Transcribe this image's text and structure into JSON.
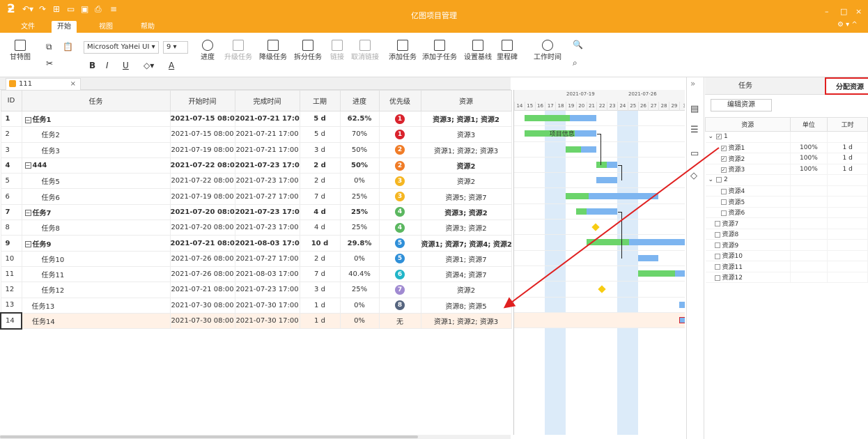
{
  "app": {
    "title": "亿图项目管理",
    "logo": "ƻ"
  },
  "menus": [
    "文件",
    "开始",
    "视图",
    "帮助"
  ],
  "window": {
    "minimize": "–",
    "maximize": "□",
    "close": "×",
    "settings": "⚙ ▾ ^"
  },
  "ribbon": {
    "gantt": "甘特图",
    "font": "Microsoft YaHei UI",
    "font_size": "9",
    "bold": "B",
    "italic": "I",
    "underline": "U",
    "font_color": "A",
    "progress": "进度",
    "upgrade": "升级任务",
    "downgrade": "降级任务",
    "split": "拆分任务",
    "link": "链接",
    "unlink": "取消链接",
    "add_task": "添加任务",
    "add_subtask": "添加子任务",
    "baseline": "设置基线",
    "milestone": "里程碑",
    "work_time": "工作时间"
  },
  "doc_tab": {
    "name": "111",
    "close": "×"
  },
  "columns": {
    "id": "ID",
    "task": "任务",
    "start": "开始时间",
    "finish": "完成时间",
    "duration": "工期",
    "progress": "进度",
    "priority": "优先级",
    "resource": "资源"
  },
  "tasks": [
    {
      "id": "1",
      "name": "任务1",
      "start": "2021-07-15 08:00",
      "finish": "2021-07-21 17:00",
      "duration": "5 d",
      "progress": "62.5%",
      "priority": "1",
      "pcolor": "#d9232d",
      "resource": "资源3; 资源1; 资源2",
      "summary": true
    },
    {
      "id": "2",
      "name": "任务2",
      "start": "2021-07-15 08:00",
      "finish": "2021-07-21 17:00",
      "duration": "5 d",
      "progress": "70%",
      "priority": "1",
      "pcolor": "#d9232d",
      "resource": "资源3",
      "summary": false
    },
    {
      "id": "3",
      "name": "任务3",
      "start": "2021-07-19 08:00",
      "finish": "2021-07-21 17:00",
      "duration": "3 d",
      "progress": "50%",
      "priority": "2",
      "pcolor": "#f07c27",
      "resource": "资源1; 资源2; 资源3",
      "summary": false
    },
    {
      "id": "4",
      "name": "444",
      "start": "2021-07-22 08:00",
      "finish": "2021-07-23 17:00",
      "duration": "2 d",
      "progress": "50%",
      "priority": "2",
      "pcolor": "#f07c27",
      "resource": "资源2",
      "summary": true
    },
    {
      "id": "5",
      "name": "任务5",
      "start": "2021-07-22 08:00",
      "finish": "2021-07-23 17:00",
      "duration": "2 d",
      "progress": "0%",
      "priority": "3",
      "pcolor": "#f5b621",
      "resource": "资源2",
      "summary": false
    },
    {
      "id": "6",
      "name": "任务6",
      "start": "2021-07-19 08:00",
      "finish": "2021-07-27 17:00",
      "duration": "7 d",
      "progress": "25%",
      "priority": "3",
      "pcolor": "#f5b621",
      "resource": "资源5; 资源7",
      "summary": false
    },
    {
      "id": "7",
      "name": "任务7",
      "start": "2021-07-20 08:00",
      "finish": "2021-07-23 17:00",
      "duration": "4 d",
      "progress": "25%",
      "priority": "4",
      "pcolor": "#5bb760",
      "resource": "资源3; 资源2",
      "summary": true
    },
    {
      "id": "8",
      "name": "任务8",
      "start": "2021-07-20 08:00",
      "finish": "2021-07-23 17:00",
      "duration": "4 d",
      "progress": "25%",
      "priority": "4",
      "pcolor": "#5bb760",
      "resource": "资源3; 资源2",
      "summary": false
    },
    {
      "id": "9",
      "name": "任务9",
      "start": "2021-07-21 08:00",
      "finish": "2021-08-03 17:00",
      "duration": "10 d",
      "progress": "29.8%",
      "priority": "5",
      "pcolor": "#2f8fd8",
      "resource": "资源1; 资源7; 资源4; 资源2",
      "summary": true
    },
    {
      "id": "10",
      "name": "任务10",
      "start": "2021-07-26 08:00",
      "finish": "2021-07-27 17:00",
      "duration": "2 d",
      "progress": "0%",
      "priority": "5",
      "pcolor": "#2f8fd8",
      "resource": "资源1; 资源7",
      "summary": false
    },
    {
      "id": "11",
      "name": "任务11",
      "start": "2021-07-26 08:00",
      "finish": "2021-08-03 17:00",
      "duration": "7 d",
      "progress": "40.4%",
      "priority": "6",
      "pcolor": "#21b5c8",
      "resource": "资源4; 资源7",
      "summary": false
    },
    {
      "id": "12",
      "name": "任务12",
      "start": "2021-07-21 08:00",
      "finish": "2021-07-23 17:00",
      "duration": "3 d",
      "progress": "25%",
      "priority": "7",
      "pcolor": "#a08ad1",
      "resource": "资源2",
      "summary": false
    },
    {
      "id": "13",
      "name": "任务13",
      "start": "2021-07-30 08:00",
      "finish": "2021-07-30 17:00",
      "duration": "1 d",
      "progress": "0%",
      "priority": "8",
      "pcolor": "#56657f",
      "resource": "资源8; 资源5",
      "summary": false
    },
    {
      "id": "14",
      "name": "任务14",
      "start": "2021-07-30 08:00",
      "finish": "2021-07-30 17:00",
      "duration": "1 d",
      "progress": "0%",
      "priority": "无",
      "pcolor": "",
      "resource": "资源1; 资源2; 资源3",
      "summary": false
    }
  ],
  "gantt": {
    "weeks": [
      "2021-07-19",
      "2021-07-26"
    ],
    "days": [
      "14",
      "15",
      "16",
      "17",
      "18",
      "19",
      "20",
      "21",
      "22",
      "23",
      "24",
      "25",
      "26",
      "27",
      "28",
      "29",
      "3"
    ],
    "bar_label": "项目信息"
  },
  "panel": {
    "tab_task": "任务",
    "tab_resource": "分配资源",
    "edit": "编辑资源",
    "col_res": "资源",
    "col_unit": "单位",
    "col_work": "工时",
    "rows": [
      {
        "label": "1",
        "level": 0,
        "expand": "⌄",
        "checked": true,
        "unit": "",
        "work": ""
      },
      {
        "label": "资源1",
        "level": 1,
        "expand": "",
        "checked": true,
        "unit": "100%",
        "work": "1 d"
      },
      {
        "label": "资源2",
        "level": 1,
        "expand": "",
        "checked": true,
        "unit": "100%",
        "work": "1 d"
      },
      {
        "label": "资源3",
        "level": 1,
        "expand": "",
        "checked": true,
        "unit": "100%",
        "work": "1 d"
      },
      {
        "label": "2",
        "level": 0,
        "expand": "⌄",
        "checked": false,
        "unit": "",
        "work": ""
      },
      {
        "label": "资源4",
        "level": 1,
        "expand": "",
        "checked": false,
        "unit": "",
        "work": ""
      },
      {
        "label": "资源5",
        "level": 1,
        "expand": "",
        "checked": false,
        "unit": "",
        "work": ""
      },
      {
        "label": "资源6",
        "level": 1,
        "expand": "",
        "checked": false,
        "unit": "",
        "work": ""
      },
      {
        "label": "资源7",
        "level": 0.5,
        "expand": "",
        "checked": false,
        "unit": "",
        "work": ""
      },
      {
        "label": "资源8",
        "level": 0.5,
        "expand": "",
        "checked": false,
        "unit": "",
        "work": ""
      },
      {
        "label": "资源9",
        "level": 0.5,
        "expand": "",
        "checked": false,
        "unit": "",
        "work": ""
      },
      {
        "label": "资源10",
        "level": 0.5,
        "expand": "",
        "checked": false,
        "unit": "",
        "work": ""
      },
      {
        "label": "资源11",
        "level": 0.5,
        "expand": "",
        "checked": false,
        "unit": "",
        "work": ""
      },
      {
        "label": "资源12",
        "level": 0.5,
        "expand": "",
        "checked": false,
        "unit": "",
        "work": ""
      }
    ]
  },
  "colors": {
    "accent": "#f7a31c",
    "done": "#6bd46b",
    "remaining": "#7db5f0",
    "milestone": "#f7cc12",
    "highlight": "#e02020"
  }
}
